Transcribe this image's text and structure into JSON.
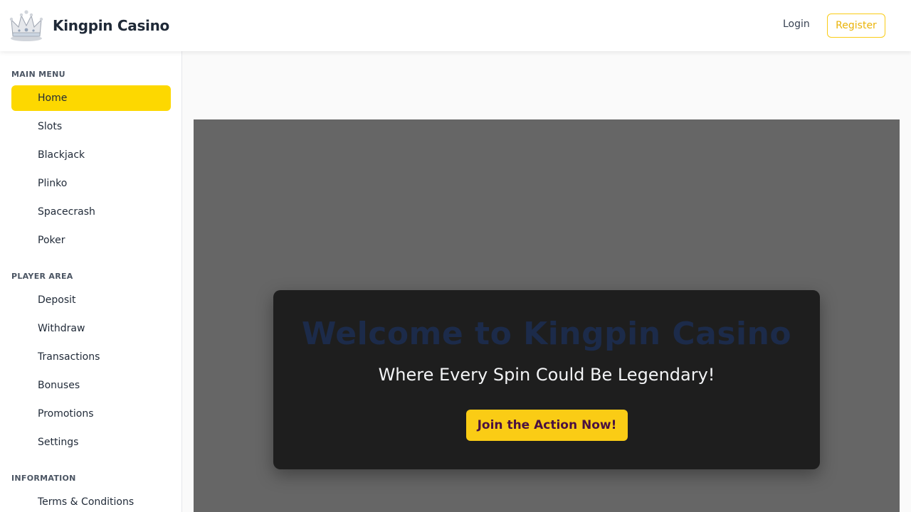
{
  "header": {
    "brand": "Kingpin Casino",
    "logo_icon": "crown-icon",
    "login_label": "Login",
    "register_label": "Register"
  },
  "sidebar": {
    "sections": [
      {
        "title": "MAIN MENU",
        "items": [
          "Home",
          "Slots",
          "Blackjack",
          "Plinko",
          "Spacecrash",
          "Poker"
        ]
      },
      {
        "title": "PLAYER AREA",
        "items": [
          "Deposit",
          "Withdraw",
          "Transactions",
          "Bonuses",
          "Promotions",
          "Settings"
        ]
      },
      {
        "title": "INFORMATION",
        "items": [
          "Terms & Conditions"
        ]
      }
    ],
    "active_item": "Home"
  },
  "hero": {
    "title": "Welcome to Kingpin Casino",
    "subtitle": "Where Every Spin Could Be Legendary!",
    "cta_label": "Join the Action Now!"
  },
  "colors": {
    "accent": "#facc15",
    "active_nav": "#fdd800",
    "hero_bg": "#666666",
    "card_bg": "#1e1e1e",
    "title_color": "#1c2b4a"
  }
}
